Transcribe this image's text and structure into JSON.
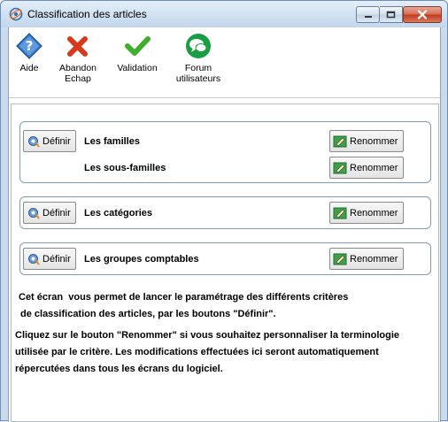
{
  "window": {
    "title": "Classification des articles",
    "accent": "#2f6fae"
  },
  "toolbar": {
    "items": [
      {
        "label": "Aide",
        "icon": "help-icon"
      },
      {
        "label": "Abandon\nEchap",
        "line1": "Abandon",
        "line2": "Echap",
        "icon": "cancel-icon"
      },
      {
        "label": "Validation",
        "icon": "check-icon"
      },
      {
        "label": "Forum utilisateurs",
        "line1": "Forum",
        "line2": "utilisateurs",
        "icon": "forum-icon"
      }
    ]
  },
  "groups": {
    "familles": {
      "define_label": "Définir",
      "label": "Les familles",
      "rename_label": "Renommer",
      "sub_label": "Les sous-familles",
      "sub_rename_label": "Renommer"
    },
    "categories": {
      "define_label": "Définir",
      "label": "Les catégories",
      "rename_label": "Renommer"
    },
    "groupes": {
      "define_label": "Définir",
      "label": "Les groupes comptables",
      "rename_label": "Renommer"
    }
  },
  "help_text": {
    "line1": "Cet écran  vous permet de lancer le paramétrage des différents critères",
    "line2": "de classification des articles, par les boutons \"Définir\".",
    "line3": "Cliquez sur le bouton \"Renommer\" si vous souhaitez personnaliser la terminologie",
    "line4": "utilisée par le critère. Les modifications effectuées ici seront automatiquement",
    "line5": "répercutées dans tous les écrans du logiciel."
  }
}
